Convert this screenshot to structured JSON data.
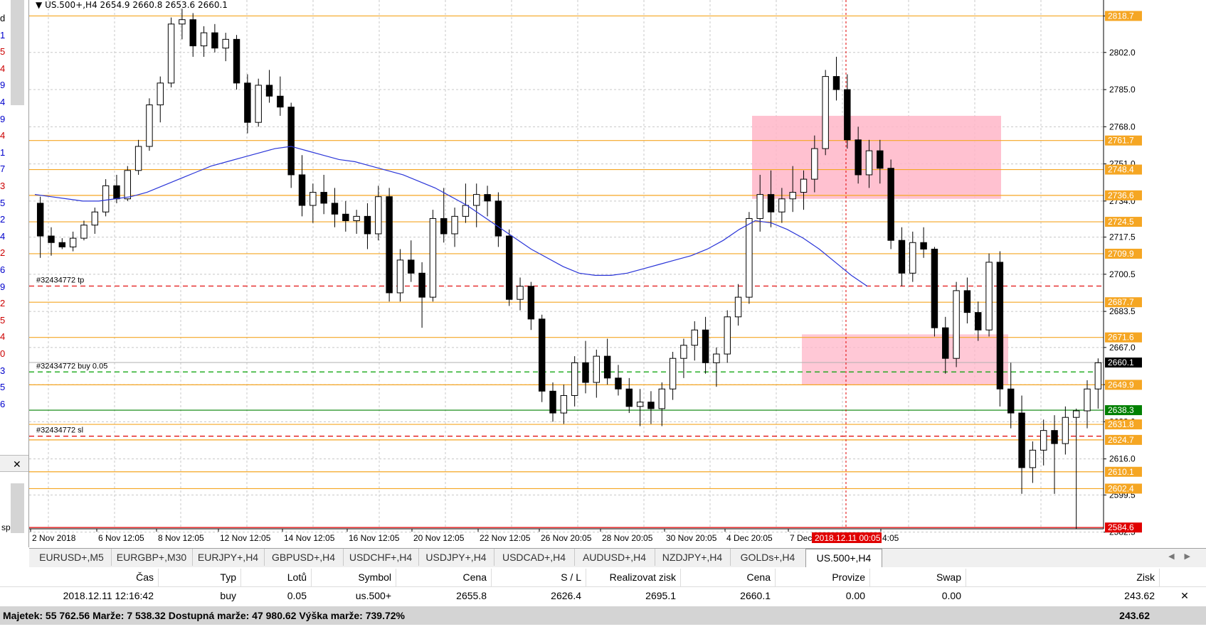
{
  "window_title": "US.500+,H4",
  "ohlc_readout": "2654.9 2660.8 2653.6 2660.1",
  "left_panel": {
    "numbers": [
      "d",
      "1",
      "5",
      "4",
      "9",
      "4",
      "9",
      "4",
      "1",
      "7",
      "3",
      "5",
      "2",
      "4",
      "2",
      "6",
      "9",
      "2",
      "5",
      "4",
      "0",
      "3",
      "5",
      "6"
    ],
    "colors": [
      "#000",
      "#0000cc",
      "#cc0000",
      "#cc0000",
      "#0000cc",
      "#0000cc",
      "#0000cc",
      "#cc0000",
      "#0000cc",
      "#0000cc",
      "#cc0000",
      "#0000cc",
      "#0000cc",
      "#0000cc",
      "#cc0000",
      "#0000cc",
      "#0000cc",
      "#cc0000",
      "#cc0000",
      "#cc0000",
      "#cc0000",
      "#0000cc",
      "#0000cc",
      "#0000cc"
    ],
    "bottom_text": "sp"
  },
  "chart_data": {
    "type": "candlestick",
    "symbol": "US.500+",
    "timeframe": "H4",
    "ylim": [
      2584,
      2826
    ],
    "price_ticks": [
      2818.7,
      2802.0,
      2785.0,
      2768.0,
      2751.0,
      2734.0,
      2717.5,
      2700.5,
      2683.5,
      2667.0,
      2650.0,
      2633.0,
      2616.0,
      2599.5,
      2582.5
    ],
    "price_tick_labels": [
      "2818.7",
      "2802.0",
      "2785.0",
      "2768.0",
      "2751.0",
      "2734.0",
      "2717.5",
      "2700.5",
      "2683.5",
      "2667.0",
      "2650.0",
      "2633.0",
      "2616.0",
      "2599.5",
      "2582.5"
    ],
    "time_labels": [
      "2 Nov 2018",
      "6 Nov 12:05",
      "8 Nov 12:05",
      "12 Nov 12:05",
      "14 Nov 12:05",
      "16 Nov 12:05",
      "20 Nov 12:05",
      "22 Nov 12:05",
      "26 Nov 20:05",
      "28 Nov 20:05",
      "30 Nov 20:05",
      "4 Dec 20:05",
      "7 Dec",
      "4:05"
    ],
    "crosshair_time_label": "2018.12.11 00:05",
    "current_price": "2660.1",
    "horizontal_levels": [
      {
        "price": 2818.7,
        "label": "2818.7",
        "color": "#f5a623"
      },
      {
        "price": 2761.7,
        "label": "2761.7",
        "color": "#f5a623"
      },
      {
        "price": 2748.4,
        "label": "2748.4",
        "color": "#f5a623"
      },
      {
        "price": 2736.6,
        "label": "2736.6",
        "color": "#f5a623"
      },
      {
        "price": 2724.5,
        "label": "2724.5",
        "color": "#f5a623"
      },
      {
        "price": 2709.9,
        "label": "2709.9",
        "color": "#f5a623"
      },
      {
        "price": 2687.7,
        "label": "2687.7",
        "color": "#f5a623"
      },
      {
        "price": 2671.6,
        "label": "2671.6",
        "color": "#f5a623"
      },
      {
        "price": 2649.9,
        "label": "2649.9",
        "color": "#f5a623"
      },
      {
        "price": 2631.8,
        "label": "2631.8",
        "color": "#f5a623"
      },
      {
        "price": 2624.7,
        "label": "2624.7",
        "color": "#f5a623"
      },
      {
        "price": 2610.1,
        "label": "2610.1",
        "color": "#f5a623"
      },
      {
        "price": 2602.4,
        "label": "2602.4",
        "color": "#f5a623"
      },
      {
        "price": 2584.6,
        "label": "2584.6",
        "color": "#e00000"
      },
      {
        "price": 2638.3,
        "label": "2638.3",
        "color": "#008000"
      }
    ],
    "order_lines": [
      {
        "label": "#32434772 tp",
        "price": 2695.1,
        "color": "#e00000"
      },
      {
        "label": "#32434772 buy 0.05",
        "price": 2655.8,
        "color": "#00a000"
      },
      {
        "label": "#32434772 sl",
        "price": 2626.4,
        "color": "#e00000"
      }
    ],
    "zones": [
      {
        "x1": 174,
        "x2": 225,
        "y1": 2735,
        "y2": 2773,
        "color": "#ffb6c8"
      },
      {
        "x1": 200,
        "x2": 226,
        "y1": 2649.9,
        "y2": 2673,
        "color": "#ffb6c8"
      }
    ],
    "candles": [
      [
        2733,
        2736,
        2708,
        2718
      ],
      [
        2718,
        2722,
        2709,
        2715
      ],
      [
        2715,
        2717,
        2712,
        2713
      ],
      [
        2713,
        2720,
        2711,
        2717
      ],
      [
        2717,
        2725,
        2716,
        2723
      ],
      [
        2723,
        2731,
        2719,
        2729
      ],
      [
        2729,
        2744,
        2727,
        2741
      ],
      [
        2741,
        2746,
        2733,
        2735
      ],
      [
        2735,
        2750,
        2734,
        2748
      ],
      [
        2748,
        2762,
        2746,
        2759
      ],
      [
        2759,
        2781,
        2757,
        2778
      ],
      [
        2778,
        2791,
        2770,
        2788
      ],
      [
        2788,
        2818,
        2786,
        2815
      ],
      [
        2815,
        2822,
        2808,
        2817
      ],
      [
        2817,
        2820,
        2800,
        2805
      ],
      [
        2805,
        2814,
        2800,
        2811
      ],
      [
        2811,
        2815,
        2802,
        2804
      ],
      [
        2804,
        2811,
        2798,
        2808
      ],
      [
        2808,
        2810,
        2785,
        2788
      ],
      [
        2788,
        2792,
        2765,
        2770
      ],
      [
        2770,
        2790,
        2768,
        2787
      ],
      [
        2787,
        2794,
        2779,
        2782
      ],
      [
        2782,
        2791,
        2773,
        2777
      ],
      [
        2777,
        2779,
        2740,
        2746
      ],
      [
        2746,
        2755,
        2727,
        2732
      ],
      [
        2732,
        2742,
        2724,
        2738
      ],
      [
        2738,
        2746,
        2728,
        2733
      ],
      [
        2733,
        2740,
        2722,
        2728
      ],
      [
        2728,
        2734,
        2720,
        2725
      ],
      [
        2725,
        2730,
        2719,
        2727
      ],
      [
        2727,
        2733,
        2712,
        2719
      ],
      [
        2719,
        2741,
        2716,
        2736
      ],
      [
        2736,
        2740,
        2688,
        2692
      ],
      [
        2692,
        2712,
        2688,
        2707
      ],
      [
        2707,
        2716,
        2697,
        2701
      ],
      [
        2701,
        2706,
        2676,
        2690
      ],
      [
        2690,
        2730,
        2688,
        2726
      ],
      [
        2726,
        2740,
        2715,
        2719
      ],
      [
        2719,
        2731,
        2713,
        2727
      ],
      [
        2727,
        2742,
        2724,
        2732
      ],
      [
        2732,
        2742,
        2722,
        2737
      ],
      [
        2737,
        2741,
        2727,
        2734
      ],
      [
        2734,
        2738,
        2713,
        2718
      ],
      [
        2718,
        2721,
        2686,
        2689
      ],
      [
        2689,
        2699,
        2684,
        2695
      ],
      [
        2695,
        2697,
        2675,
        2680
      ],
      [
        2680,
        2682,
        2642,
        2647
      ],
      [
        2647,
        2651,
        2633,
        2637
      ],
      [
        2637,
        2650,
        2632,
        2645
      ],
      [
        2645,
        2663,
        2640,
        2660
      ],
      [
        2660,
        2670,
        2646,
        2651
      ],
      [
        2651,
        2666,
        2644,
        2663
      ],
      [
        2663,
        2671,
        2650,
        2653
      ],
      [
        2653,
        2659,
        2645,
        2648
      ],
      [
        2648,
        2653,
        2637,
        2640
      ],
      [
        2640,
        2648,
        2631,
        2642
      ],
      [
        2642,
        2647,
        2632,
        2639
      ],
      [
        2639,
        2651,
        2631,
        2648
      ],
      [
        2648,
        2665,
        2643,
        2662
      ],
      [
        2662,
        2671,
        2653,
        2668
      ],
      [
        2668,
        2679,
        2661,
        2675
      ],
      [
        2675,
        2681,
        2655,
        2660
      ],
      [
        2660,
        2667,
        2649,
        2664
      ],
      [
        2664,
        2684,
        2660,
        2681
      ],
      [
        2681,
        2696,
        2677,
        2690
      ],
      [
        2690,
        2729,
        2687,
        2726
      ],
      [
        2726,
        2746,
        2720,
        2737
      ],
      [
        2737,
        2748,
        2722,
        2729
      ],
      [
        2729,
        2740,
        2724,
        2735
      ],
      [
        2735,
        2750,
        2729,
        2738
      ],
      [
        2738,
        2748,
        2730,
        2744
      ],
      [
        2744,
        2764,
        2738,
        2758
      ],
      [
        2758,
        2794,
        2755,
        2791
      ],
      [
        2791,
        2800,
        2780,
        2785
      ],
      [
        2785,
        2792,
        2758,
        2762
      ],
      [
        2762,
        2768,
        2742,
        2746
      ],
      [
        2746,
        2762,
        2740,
        2757
      ],
      [
        2757,
        2762,
        2742,
        2749
      ],
      [
        2749,
        2753,
        2712,
        2716
      ],
      [
        2716,
        2722,
        2695,
        2701
      ],
      [
        2701,
        2720,
        2697,
        2715
      ],
      [
        2715,
        2722,
        2708,
        2712
      ],
      [
        2712,
        2713,
        2672,
        2676
      ],
      [
        2676,
        2681,
        2655,
        2662
      ],
      [
        2662,
        2697,
        2658,
        2693
      ],
      [
        2693,
        2699,
        2678,
        2683
      ],
      [
        2683,
        2688,
        2670,
        2675
      ],
      [
        2675,
        2710,
        2672,
        2706
      ],
      [
        2706,
        2711,
        2640,
        2648
      ],
      [
        2648,
        2660,
        2630,
        2637
      ],
      [
        2637,
        2645,
        2600,
        2612
      ],
      [
        2612,
        2624,
        2605,
        2620
      ],
      [
        2620,
        2634,
        2613,
        2629
      ],
      [
        2629,
        2636,
        2600,
        2623
      ],
      [
        2623,
        2640,
        2618,
        2635
      ],
      [
        2635,
        2639,
        2584,
        2638
      ],
      [
        2638,
        2652,
        2630,
        2648
      ],
      [
        2648,
        2662,
        2639,
        2660
      ]
    ],
    "ma_line": [
      2737,
      2736,
      2735,
      2734,
      2734,
      2735,
      2736,
      2738,
      2741,
      2744,
      2747,
      2750,
      2752,
      2754,
      2756,
      2758,
      2759,
      2757,
      2755,
      2753,
      2752,
      2750,
      2748,
      2746,
      2743,
      2740,
      2736,
      2732,
      2727,
      2722,
      2717,
      2712,
      2708,
      2704,
      2701,
      2700,
      2700,
      2701,
      2703,
      2705,
      2707,
      2709,
      2712,
      2716,
      2721,
      2725,
      2724,
      2721,
      2717,
      2712,
      2706,
      2700,
      2695
    ]
  },
  "tabs": [
    {
      "label": "EURUSD+,M5",
      "active": false
    },
    {
      "label": "EURGBP+,M30",
      "active": false
    },
    {
      "label": "EURJPY+,H4",
      "active": false
    },
    {
      "label": "GBPUSD+,H4",
      "active": false
    },
    {
      "label": "USDCHF+,H4",
      "active": false
    },
    {
      "label": "USDJPY+,H4",
      "active": false
    },
    {
      "label": "USDCAD+,H4",
      "active": false
    },
    {
      "label": "AUDUSD+,H4",
      "active": false
    },
    {
      "label": "NZDJPY+,H4",
      "active": false
    },
    {
      "label": "GOLDs+,H4",
      "active": false
    },
    {
      "label": "US.500+,H4",
      "active": true
    }
  ],
  "terminal": {
    "headers": [
      "Čas",
      "Typ",
      "Lotů",
      "Symbol",
      "Cena",
      "S / L",
      "Realizovat zisk",
      "Cena",
      "Provize",
      "Swap",
      "Zisk"
    ],
    "row": [
      "2018.12.11 12:16:42",
      "buy",
      "0.05",
      "us.500+",
      "2655.8",
      "2626.4",
      "2695.1",
      "2660.1",
      "0.00",
      "0.00",
      "243.62"
    ]
  },
  "status": {
    "text": "Majetek: 55 762.56  Marže: 7 538.32  Dostupná marže: 47 980.62  Výška marže: 739.72%",
    "total": "243.62"
  }
}
